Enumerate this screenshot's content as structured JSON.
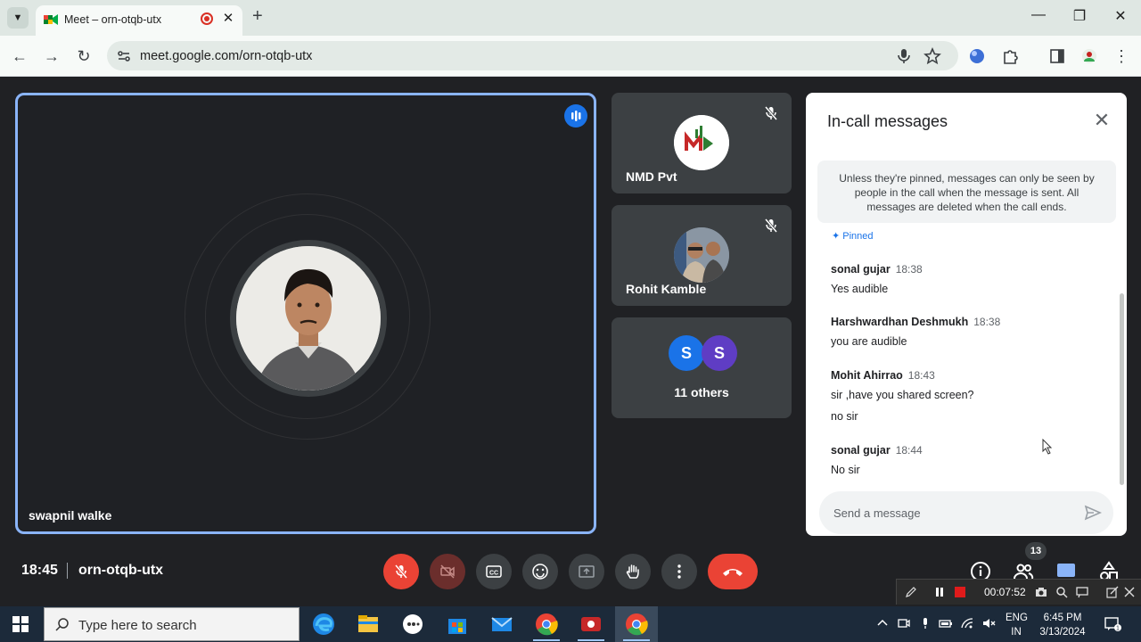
{
  "browser": {
    "tab_title": "Meet – orn-otqb-utx",
    "url": "meet.google.com/orn-otqb-utx",
    "new_tab_label": "+",
    "close_tab_label": "✕"
  },
  "meeting": {
    "time": "18:45",
    "code": "orn-otqb-utx",
    "main_participant": "swapnil walke",
    "tiles": [
      {
        "name": "NMD Pvt",
        "muted": true
      },
      {
        "name": "Rohit Kamble",
        "muted": true
      }
    ],
    "others": {
      "label": "11 others",
      "avatars": [
        {
          "letter": "S",
          "color": "#1a73e8"
        },
        {
          "letter": "S",
          "color": "#5f3dc4"
        }
      ]
    },
    "people_count": "13",
    "recording_time": "00:07:52"
  },
  "chat": {
    "title": "In-call messages",
    "notice": "Unless they're pinned, messages can only be seen by people in the call when the message is sent. All messages are deleted when the call ends.",
    "pinned_label": "Pinned",
    "messages": [
      {
        "sender": "sonal gujar",
        "time": "18:38",
        "lines": [
          "Yes audible"
        ]
      },
      {
        "sender": "Harshwardhan Deshmukh",
        "time": "18:38",
        "lines": [
          "you are audible"
        ]
      },
      {
        "sender": "Mohit Ahirrao",
        "time": "18:43",
        "lines": [
          "sir ,have you shared screen?",
          "no sir"
        ]
      },
      {
        "sender": "sonal gujar",
        "time": "18:44",
        "lines": [
          "No sir"
        ]
      }
    ],
    "input_placeholder": "Send a message"
  },
  "taskbar": {
    "search_placeholder": "Type here to search",
    "lang_1": "ENG",
    "lang_2": "IN",
    "clock_time": "6:45 PM",
    "clock_date": "3/13/2024",
    "notification_count": "1"
  },
  "colors": {
    "accent": "#8ab4f8",
    "danger": "#ea4335",
    "meet_bg": "#202124"
  }
}
